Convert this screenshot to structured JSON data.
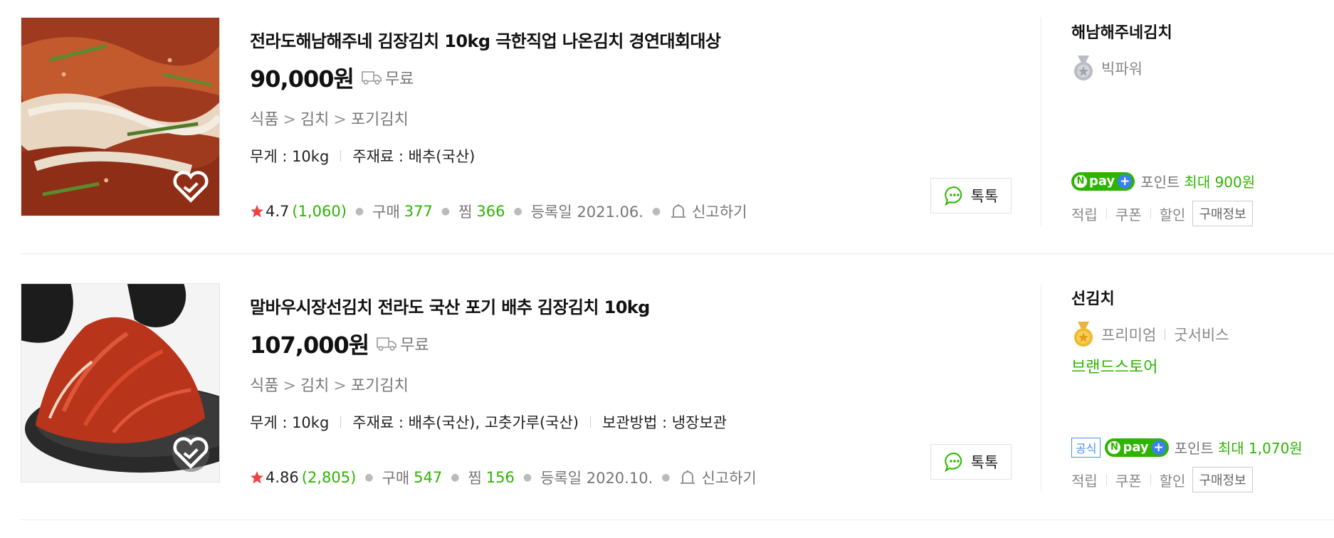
{
  "products": [
    {
      "title": "전라도해남해주네 김장김치 10kg 극한직업 나온김치 경연대회대상",
      "price": "90,000원",
      "shipping": "무료",
      "category": [
        "식품",
        "김치",
        "포기김치"
      ],
      "category_sep": ">",
      "specs": [
        "무게 : 10kg",
        "주재료 : 배추(국산)"
      ],
      "rating": "4.7",
      "review_count": "(1,060)",
      "purchase_label": "구매",
      "purchase_count": "377",
      "zzim_label": "찜",
      "zzim_count": "366",
      "registered": "등록일 2021.06.",
      "report_label": "신고하기",
      "talk_label": "톡톡",
      "mall_name": "해남해주네김치",
      "grade": "빅파워",
      "grade_icon": "silver-medal-icon",
      "grade_extra": "",
      "brand_store": "",
      "official_badge": "",
      "npay_label": "pay",
      "point_label": "포인트",
      "point_max": "최대 900원",
      "benefits": [
        "적립",
        "쿠폰",
        "할인"
      ],
      "buy_info_label": "구매정보"
    },
    {
      "title": "말바우시장선김치 전라도 국산 포기 배추 김장김치 10kg",
      "price": "107,000원",
      "shipping": "무료",
      "category": [
        "식품",
        "김치",
        "포기김치"
      ],
      "category_sep": ">",
      "specs": [
        "무게 : 10kg",
        "주재료 : 배추(국산), 고춧가루(국산)",
        "보관방법 : 냉장보관"
      ],
      "rating": "4.86",
      "review_count": "(2,805)",
      "purchase_label": "구매",
      "purchase_count": "547",
      "zzim_label": "찜",
      "zzim_count": "156",
      "registered": "등록일 2020.10.",
      "report_label": "신고하기",
      "talk_label": "톡톡",
      "mall_name": "선김치",
      "grade": "프리미엄",
      "grade_icon": "gold-medal-icon",
      "grade_extra": "굿서비스",
      "brand_store": "브랜드스토어",
      "official_badge": "공식",
      "npay_label": "pay",
      "point_label": "포인트",
      "point_max": "최대 1,070원",
      "benefits": [
        "적립",
        "쿠폰",
        "할인"
      ],
      "buy_info_label": "구매정보"
    }
  ],
  "colors": {
    "accent_green": "#2db400",
    "star_red": "#f04242",
    "npay_blue": "#3b7ff2",
    "official_blue": "#4a8ef0"
  }
}
